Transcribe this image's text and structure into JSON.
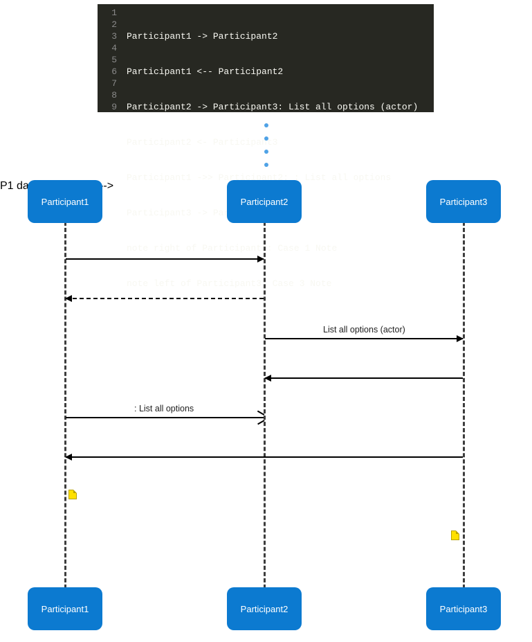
{
  "code": {
    "line_numbers": [
      "1",
      "2",
      "3",
      "4",
      "5",
      "6",
      "7",
      "8",
      "9"
    ],
    "lines": [
      "Participant1 -> Participant2",
      "Participant1 <-- Participant2",
      "Participant2 -> Participant3: List all options (actor)",
      "Participant2 <- Participant3",
      "Participant1 ->> Participant2: : List all options",
      "Participant3 -> Participant1",
      "note right of Participant1: Case 1 Note",
      "note left of Participant3: Case 3 Note",
      ""
    ]
  },
  "participants": {
    "p1": "Participant1",
    "p2": "Participant2",
    "p3": "Participant3"
  },
  "messages": {
    "m3_label": "List all options (actor)",
    "m5_label": ": List all options"
  },
  "notes": {
    "n1": "Case 1 Note",
    "n2": "Case 3 Note"
  },
  "chart_data": {
    "type": "sequence",
    "participants": [
      "Participant1",
      "Participant2",
      "Participant3"
    ],
    "events": [
      {
        "from": "Participant1",
        "to": "Participant2",
        "style": "solid",
        "head": "filled"
      },
      {
        "from": "Participant2",
        "to": "Participant1",
        "style": "dashed",
        "head": "filled"
      },
      {
        "from": "Participant2",
        "to": "Participant3",
        "style": "solid",
        "head": "filled",
        "label": "List all options (actor)"
      },
      {
        "from": "Participant3",
        "to": "Participant2",
        "style": "solid",
        "head": "filled"
      },
      {
        "from": "Participant1",
        "to": "Participant2",
        "style": "solid",
        "head": "open",
        "label": ": List all options"
      },
      {
        "from": "Participant3",
        "to": "Participant1",
        "style": "solid",
        "head": "filled"
      },
      {
        "type": "note",
        "target": "Participant1",
        "side": "right",
        "text": "Case 1 Note"
      },
      {
        "type": "note",
        "target": "Participant3",
        "side": "left",
        "text": "Case 3 Note"
      }
    ]
  },
  "colors": {
    "participant_fill": "#0c7ad0",
    "editor_bg": "#272822",
    "dot": "#4fa2e6"
  }
}
